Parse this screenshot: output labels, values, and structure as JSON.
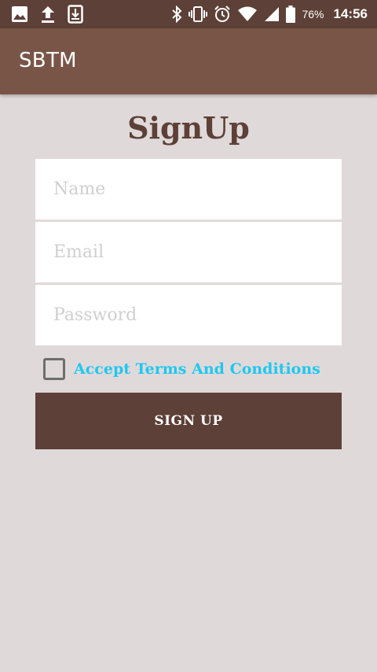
{
  "status_bar": {
    "battery_percent": "76%",
    "time": "14:56",
    "left_icons": [
      "image-icon",
      "upload-icon",
      "download-icon"
    ],
    "right_icons": [
      "bluetooth-icon",
      "vibrate-icon",
      "alarm-icon",
      "wifi-icon",
      "signal-icon",
      "battery-icon"
    ]
  },
  "app_bar": {
    "title": "SBTM"
  },
  "form": {
    "title": "SignUp",
    "name_placeholder": "Name",
    "email_placeholder": "Email",
    "password_placeholder": "Password",
    "terms_label": "Accept Terms And Conditions",
    "terms_checked": false,
    "submit_label": "SIGN UP"
  },
  "colors": {
    "status_bar": "#5d4037",
    "app_bar": "#795548",
    "background": "#e0d9da",
    "primary_dark": "#5d4037",
    "accent": "#1ec8ef"
  }
}
